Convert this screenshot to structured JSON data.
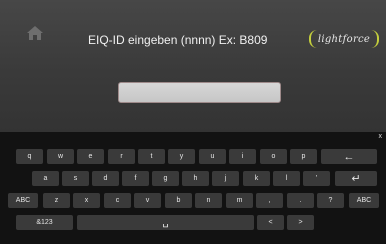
{
  "header": {
    "title": "EIQ-ID eingeben (nnnn) Ex: B809",
    "logo_text": "lightforce",
    "home_icon": "home-icon"
  },
  "input": {
    "value": "",
    "placeholder": ""
  },
  "keyboard": {
    "close": "x",
    "row1": [
      "q",
      "w",
      "e",
      "r",
      "t",
      "y",
      "u",
      "i",
      "o",
      "p"
    ],
    "backspace": "←",
    "row2": [
      "a",
      "s",
      "d",
      "f",
      "g",
      "h",
      "j",
      "k",
      "l",
      "'"
    ],
    "enter": "↵",
    "shift_left": "ABC",
    "row3": [
      "z",
      "x",
      "c",
      "v",
      "b",
      "n",
      "m",
      ",",
      "."
    ],
    "question": "?",
    "shift_right": "ABC",
    "symbols": "&123",
    "space": "␣",
    "left": "<",
    "right": ">"
  },
  "colors": {
    "accent": "#c4cf3c"
  }
}
